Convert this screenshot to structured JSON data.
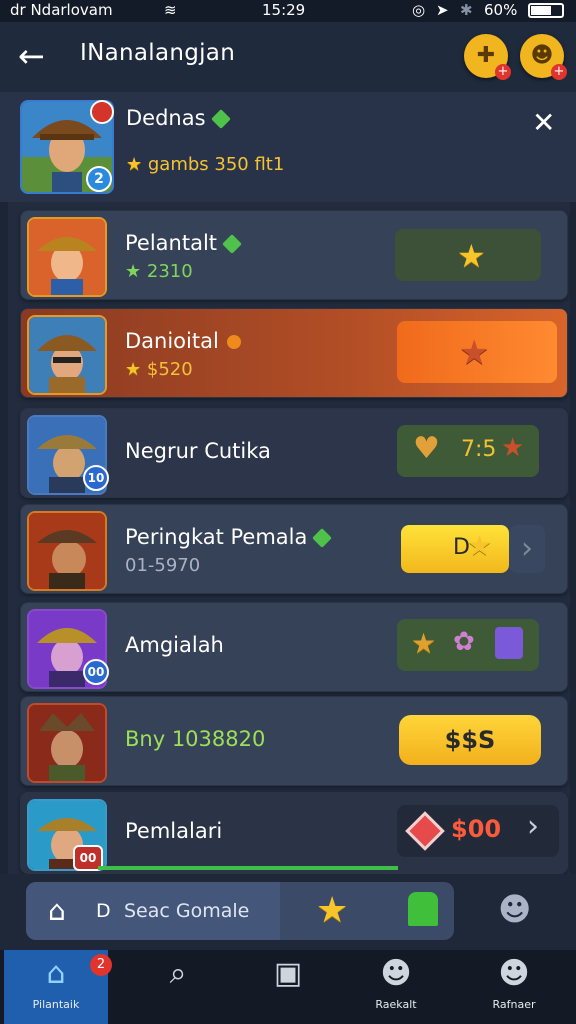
{
  "status": {
    "left": "dr Ndarlovam",
    "time": "15:29",
    "battery": "60%"
  },
  "header": {
    "title": "INanalangjan"
  },
  "profile": {
    "name": "Dednas",
    "sub": "gambs 350 flt1",
    "level": "2"
  },
  "rows": [
    {
      "name": "Pelantalt",
      "sub": "2310",
      "action": ""
    },
    {
      "name": "Danioital",
      "sub": "$520",
      "action": ""
    },
    {
      "name": "Negrur Cutika",
      "sub": "",
      "action": "7:5",
      "level": "10"
    },
    {
      "name": "Peringkat Pemala",
      "sub": "01-5970",
      "action": "D"
    },
    {
      "name": "Amgialah",
      "sub": "",
      "action": "",
      "level": "00"
    },
    {
      "name": "Bny 1038820",
      "sub": "",
      "action": "$$S"
    },
    {
      "name": "Pemlalari",
      "sub": "",
      "action": "$00",
      "level": "00"
    }
  ],
  "dock": {
    "home_text": "D",
    "search_text": "Seac Gomale"
  },
  "tabs": [
    {
      "label": "Pilantaik",
      "icon": "home-icon",
      "badge": "2"
    },
    {
      "label": "",
      "icon": "search-icon"
    },
    {
      "label": "",
      "icon": "box-icon"
    },
    {
      "label": "Raekalt",
      "icon": "person-icon"
    },
    {
      "label": "Rafnaer",
      "icon": "person-icon"
    }
  ],
  "colors": {
    "accent_gold": "#f1b61f",
    "highlight_row": "#c25a24",
    "active_tab": "#1f5fae",
    "green_chip": "#3f6a3a"
  }
}
